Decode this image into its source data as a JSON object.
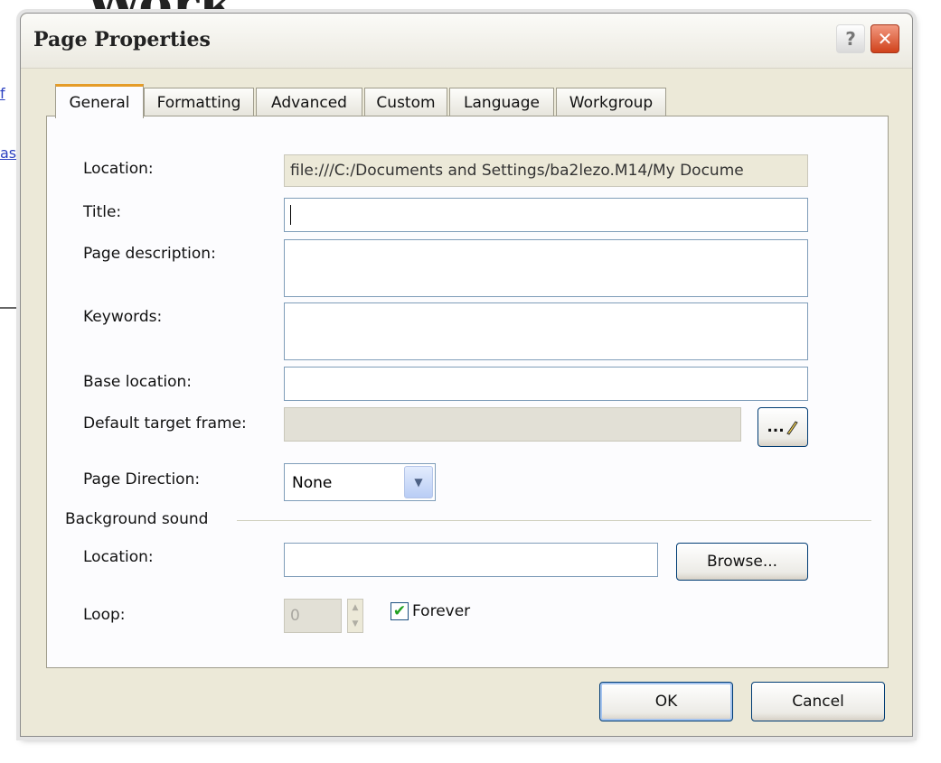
{
  "background": {
    "heading_fragment": "Work",
    "link_fragments": [
      "as",
      "f"
    ]
  },
  "dialog": {
    "title": "Page Properties",
    "help_label": "?",
    "close_label": "✕"
  },
  "tabs": [
    {
      "label": "General",
      "active": true
    },
    {
      "label": "Formatting",
      "active": false
    },
    {
      "label": "Advanced",
      "active": false
    },
    {
      "label": "Custom",
      "active": false
    },
    {
      "label": "Language",
      "active": false
    },
    {
      "label": "Workgroup",
      "active": false
    }
  ],
  "general": {
    "location_label": "Location:",
    "location_value": "file:///C:/Documents and Settings/ba2lezo.M14/My Docume",
    "title_label": "Title:",
    "title_value": "",
    "description_label": "Page description:",
    "description_value": "",
    "keywords_label": "Keywords:",
    "keywords_value": "",
    "base_location_label": "Base location:",
    "base_location_value": "",
    "target_frame_label": "Default target frame:",
    "target_frame_value": "",
    "target_frame_button": "...",
    "direction_label": "Page Direction:",
    "direction_value": "None",
    "direction_arrow": "▼"
  },
  "background_sound": {
    "group_label": "Background sound",
    "location_label": "Location:",
    "location_value": "",
    "browse_label": "Browse...",
    "loop_label": "Loop:",
    "loop_value": "0",
    "forever_label": "Forever",
    "forever_checked": true,
    "check_mark": "✔"
  },
  "footer": {
    "ok_label": "OK",
    "cancel_label": "Cancel"
  },
  "colors": {
    "dialog_face": "#ece9d8",
    "active_tab_accent": "#e59c27",
    "close_button": "#d0421b",
    "input_border": "#7f9db9"
  }
}
